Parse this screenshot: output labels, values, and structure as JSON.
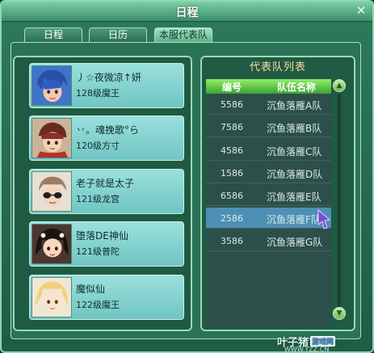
{
  "window": {
    "title": "日程",
    "close_glyph": "✕"
  },
  "tabs": [
    {
      "label": "日程",
      "active": false
    },
    {
      "label": "日历",
      "active": false
    },
    {
      "label": "本服代表队",
      "active": true
    }
  ],
  "members": [
    {
      "name": "丿☆夜微凉↑妍",
      "level": "128级魔王",
      "avatar": "blue-hair-portrait"
    },
    {
      "name": "丷。魂挽歌°ら",
      "level": "120级方寸",
      "avatar": "red-cap-portrait"
    },
    {
      "name": "老子就是太子",
      "level": "121级龙宫",
      "avatar": "sunglasses-portrait"
    },
    {
      "name": "堕落DE神仙",
      "level": "121级普陀",
      "avatar": "dark-hair-portrait"
    },
    {
      "name": "魔似仙",
      "level": "122级魔王",
      "avatar": "blonde-portrait"
    }
  ],
  "team_list": {
    "title": "代表队列表",
    "col_id": "编号",
    "col_name": "队伍名称",
    "rows": [
      {
        "id": "5586",
        "name": "沉鱼落雁A队",
        "selected": false
      },
      {
        "id": "7586",
        "name": "沉鱼落雁B队",
        "selected": false
      },
      {
        "id": "4586",
        "name": "沉鱼落雁C队",
        "selected": false
      },
      {
        "id": "1586",
        "name": "沉鱼落雁D队",
        "selected": false
      },
      {
        "id": "6586",
        "name": "沉鱼落雁E队",
        "selected": false
      },
      {
        "id": "2586",
        "name": "沉鱼落雁F队",
        "selected": true
      },
      {
        "id": "3586",
        "name": "沉鱼落雁G队",
        "selected": false
      }
    ]
  },
  "watermark": {
    "text": "叶子猪",
    "badge": "游戏网",
    "url": "WWW.YZZ.CN"
  },
  "colors": {
    "selected_row": "#4e8fb5",
    "header_green": "#5bc43f",
    "title_orange": "#ffd9a0"
  }
}
